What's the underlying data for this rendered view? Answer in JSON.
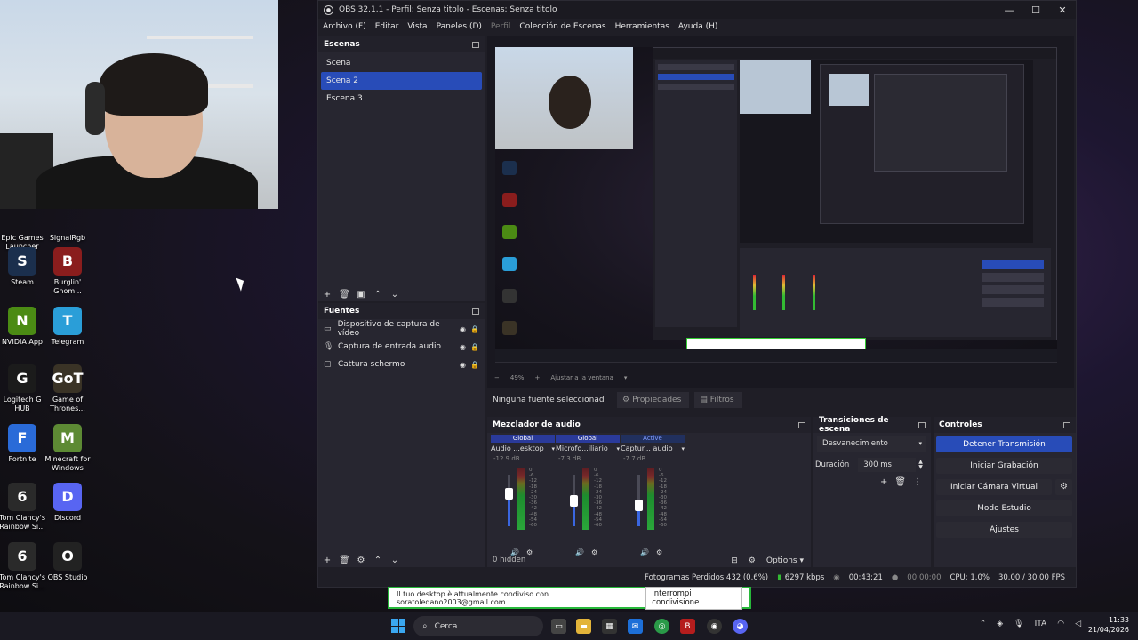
{
  "desktop": {
    "icons": [
      {
        "label": "Epic Games Launcher",
        "glyph": "",
        "color": "#1b1b1b"
      },
      {
        "label": "SignalRgb",
        "glyph": "",
        "color": "#1b1b1b"
      },
      {
        "label": "Steam",
        "glyph": "S",
        "color": "#1b2f4d"
      },
      {
        "label": "Burglin' Gnom...",
        "glyph": "B",
        "color": "#8a1d1d"
      },
      {
        "label": "NVIDIA App",
        "glyph": "N",
        "color": "#4b8b14"
      },
      {
        "label": "Telegram",
        "glyph": "T",
        "color": "#2a9ed8"
      },
      {
        "label": "Logitech G HUB",
        "glyph": "G",
        "color": "#1b1b1b"
      },
      {
        "label": "Game of Thrones...",
        "glyph": "GoT",
        "color": "#3a3326"
      },
      {
        "label": "Fortnite",
        "glyph": "F",
        "color": "#2a6bd8"
      },
      {
        "label": "Minecraft for Windows",
        "glyph": "M",
        "color": "#5d8a34"
      },
      {
        "label": "Tom Clancy's Rainbow Si...",
        "glyph": "6",
        "color": "#2a2a2a"
      },
      {
        "label": "Discord",
        "glyph": "D",
        "color": "#5865f2"
      },
      {
        "label": "Tom Clancy's Rainbow Si...",
        "glyph": "6",
        "color": "#2a2a2a"
      },
      {
        "label": "OBS Studio",
        "glyph": "O",
        "color": "#222"
      }
    ]
  },
  "obs": {
    "title": "OBS 32.1.1 - Perfil: Senza titolo - Escenas: Senza titolo",
    "menu": [
      "Archivo (F)",
      "Editar",
      "Vista",
      "Paneles (D)",
      "Perfil",
      "Colección de Escenas",
      "Herramientas",
      "Ayuda (H)"
    ],
    "scenes": {
      "title": "Escenas",
      "items": [
        "Scena",
        "Scena 2",
        "Escena 3"
      ],
      "selected": "Scena 2"
    },
    "sources": {
      "title": "Fuentes",
      "items": [
        {
          "label": "Dispositivo de captura de vídeo",
          "icon": "camera-icon"
        },
        {
          "label": "Captura de entrada audio",
          "icon": "microphone-icon"
        },
        {
          "label": "Cattura schermo",
          "icon": "monitor-icon"
        }
      ]
    },
    "preview": {
      "zoom": "49%",
      "zoom_mode": "Ajustar a la ventana"
    },
    "source_bar": {
      "no_source": "Ninguna fuente seleccionad",
      "properties": "Propiedades",
      "filters": "Filtros"
    },
    "mixer": {
      "title": "Mezclador de audio",
      "channels": [
        {
          "tag": "Global",
          "name": "Audio ...esktop",
          "db": "-12.9 dB",
          "level": 0.7
        },
        {
          "tag": "Global",
          "name": "Microfo...iliario",
          "db": "-7.3 dB",
          "level": 0.55
        },
        {
          "tag": "Active",
          "name": "Captur... audio",
          "db": "-7.7 dB",
          "level": 0.45
        }
      ],
      "scale": [
        "0",
        "-6",
        "-12",
        "-18",
        "-24",
        "-30",
        "-36",
        "-42",
        "-48",
        "-54",
        "-60"
      ],
      "hidden": "0 hidden",
      "options": "Options"
    },
    "transitions": {
      "title": "Transiciones de escena",
      "type": "Desvanecimiento",
      "duration_label": "Duración",
      "duration": "300 ms"
    },
    "controls": {
      "title": "Controles",
      "stop_stream": "Detener Transmisión",
      "start_record": "Iniciar Grabación",
      "virtual_cam": "Iniciar Cámara Virtual",
      "studio": "Modo Estudio",
      "settings": "Ajustes"
    },
    "status": {
      "dropped": "Fotogramas Perdidos 432 (0.6%)",
      "kbps": "6297 kbps",
      "stream_time": "00:43:21",
      "rec_time": "00:00:00",
      "cpu": "CPU: 1.0%",
      "fps": "30.00 / 30.00 FPS"
    }
  },
  "share": {
    "message": "Il tuo desktop è attualmente condiviso con soratoledano2003@gmail.com",
    "stop": "Interrompi condivisione"
  },
  "taskbar": {
    "search": "Cerca",
    "lang": "ITA",
    "time": "11:33",
    "date": "21/04/2026"
  }
}
